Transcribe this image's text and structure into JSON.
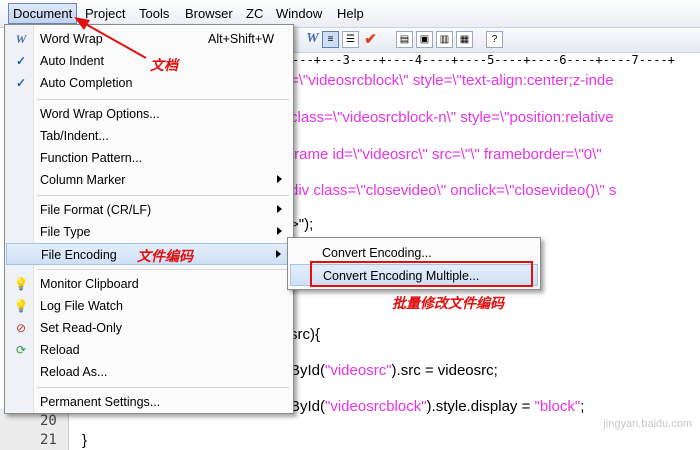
{
  "menubar": {
    "items": [
      "Document",
      "Project",
      "Tools",
      "Browser",
      "ZC",
      "Window",
      "Help"
    ]
  },
  "ruler": {
    "text": "---+---3----+----4----+----5----+----6----+----7----+"
  },
  "editor": {
    "lines": [
      {
        "text": "=\\\"videosrcblock\\\" style=\\\"text-align:center;z-inde"
      },
      {
        "text": "class=\\\"videosrcblock-n\\\" style=\\\"position:relative"
      },
      {
        "text": "frame id=\\\"videosrc\\\" src=\\\"\\\" frameborder=\\\"0\\\""
      },
      {
        "text": "div class=\\\"closevideo\\\" onclick=\\\"closevideo()\\\" s"
      },
      {
        "text": ">\");"
      },
      {
        "text": "src){"
      },
      {
        "pre": "ById(",
        "str": "\"videosrc\"",
        "post": ").src = videosrc;"
      },
      {
        "pre": "ById(",
        "str": "\"videosrcblock\"",
        "post": ").style.display = ",
        "str2": "\"block\"",
        "post2": ";"
      },
      {
        "text": "}"
      }
    ],
    "line_numbers": [
      "20",
      "21"
    ]
  },
  "document_menu": {
    "items": {
      "word_wrap": {
        "label": "Word Wrap",
        "shortcut": "Alt+Shift+W"
      },
      "auto_indent": {
        "label": "Auto Indent"
      },
      "auto_completion": {
        "label": "Auto Completion"
      },
      "word_wrap_options": {
        "label": "Word Wrap Options..."
      },
      "tab_indent": {
        "label": "Tab/Indent..."
      },
      "function_pattern": {
        "label": "Function Pattern..."
      },
      "column_marker": {
        "label": "Column Marker"
      },
      "file_format": {
        "label": "File Format (CR/LF)"
      },
      "file_type": {
        "label": "File Type"
      },
      "file_encoding": {
        "label": "File Encoding"
      },
      "monitor_clipboard": {
        "label": "Monitor Clipboard"
      },
      "log_file_watch": {
        "label": "Log File Watch"
      },
      "set_read_only": {
        "label": "Set Read-Only"
      },
      "reload": {
        "label": "Reload"
      },
      "reload_as": {
        "label": "Reload As..."
      },
      "permanent_settings": {
        "label": "Permanent Settings..."
      }
    }
  },
  "encoding_submenu": {
    "items": [
      "Convert Encoding...",
      "Convert Encoding Multiple..."
    ]
  },
  "annotations": {
    "document": "文档",
    "file_encoding": "文件编码",
    "batch_convert": "批量修改文件编码"
  },
  "watermark": "jingyan.baidu.com",
  "colors": {
    "accent_red": "#e01010",
    "code_pink": "#e535e5",
    "highlight": "#cfe0f5"
  }
}
